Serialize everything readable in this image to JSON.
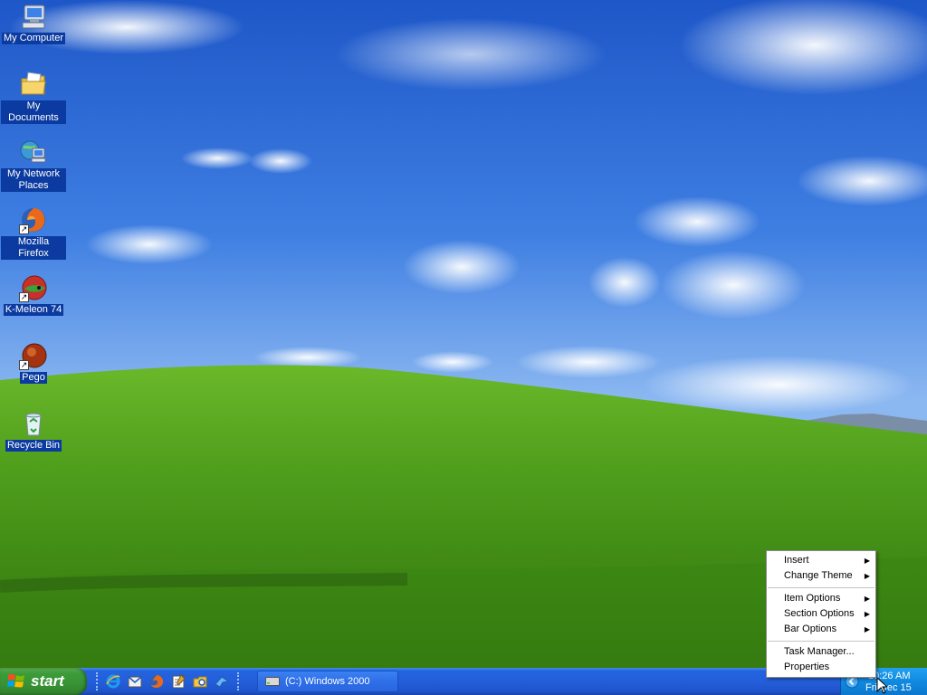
{
  "desktop": {
    "icons": [
      {
        "label": "My Computer",
        "icon": "my-computer-icon"
      },
      {
        "label": "My Documents",
        "icon": "my-documents-icon"
      },
      {
        "label": "My Network Places",
        "icon": "network-places-icon"
      },
      {
        "label": "Mozilla Firefox",
        "icon": "firefox-icon"
      },
      {
        "label": "K-Meleon 74",
        "icon": "k-meleon-icon"
      },
      {
        "label": "Pego",
        "icon": "pego-icon"
      },
      {
        "label": "Recycle Bin",
        "icon": "recycle-bin-icon"
      }
    ]
  },
  "taskbar": {
    "start_label": "start",
    "quick_launch": [
      "ie-icon",
      "outlook-icon",
      "firefox-icon",
      "notepad-icon",
      "explorer-icon",
      "messenger-icon"
    ],
    "task_button_label": "(C:) Windows 2000",
    "tray": {
      "time": "10:26 AM",
      "date": "Fri Dec 15"
    }
  },
  "context_menu": {
    "items": [
      {
        "label": "Insert",
        "submenu": true
      },
      {
        "label": "Change Theme",
        "submenu": true
      },
      {
        "label": "Item Options",
        "submenu": true
      },
      {
        "label": "Section Options",
        "submenu": true
      },
      {
        "label": "Bar Options",
        "submenu": true
      },
      {
        "label": "Task Manager...",
        "submenu": false
      },
      {
        "label": "Properties",
        "submenu": false
      }
    ]
  },
  "colors": {
    "taskbar_blue": "#245edb",
    "start_green": "#3c9c3a",
    "tray_blue": "#0f8ae0",
    "label_highlight": "#0b3aa0"
  }
}
